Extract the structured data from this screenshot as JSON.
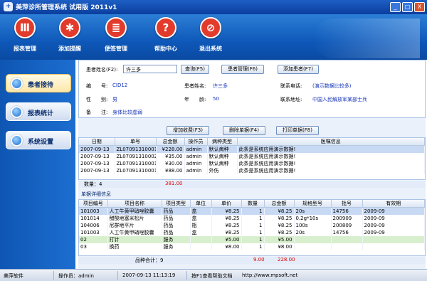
{
  "window": {
    "title": "美萍诊所管理系统 试用版 2011v1",
    "buttons": [
      "_",
      "□",
      "X"
    ]
  },
  "toolbar": [
    {
      "label": "报表管理",
      "icon": "bar-chart-icon",
      "glyph": "Ⅲ",
      "color": "#e23b2c"
    },
    {
      "label": "添加提醒",
      "icon": "alarm-clock-icon",
      "glyph": "✱",
      "color": "#e23b2c"
    },
    {
      "label": "便签管理",
      "icon": "notepad-icon",
      "glyph": "≣",
      "color": "#e23b2c"
    },
    {
      "label": "帮助中心",
      "icon": "help-icon",
      "glyph": "?",
      "color": "#e23b2c"
    },
    {
      "label": "退出系统",
      "icon": "exit-icon",
      "glyph": "⊘",
      "color": "#e23b2c"
    }
  ],
  "sidebar": [
    {
      "label": "患者接待",
      "active": true
    },
    {
      "label": "报表统计",
      "active": false
    },
    {
      "label": "系统设置",
      "active": false
    }
  ],
  "form": {
    "search_label": "患者姓名(F2):",
    "search_value": "许三多",
    "query_btn": "查询(F5)",
    "manage_btn": "患者管理(F6)",
    "add_btn": "添加患者(F7)",
    "name_label": "患者姓名:",
    "name_value": "许三多",
    "phone_label": "联系电话:",
    "phone_value": "(演示数据比较多)",
    "id_label": "编　　号:",
    "id_value": "CID12",
    "sex_label": "性　　别:",
    "sex_value": "男",
    "age_label": "年　　龄:",
    "age_value": "50",
    "addr_label": "联系地址:",
    "addr_value": "中国人民解放军某部士兵",
    "note_label": "备　　注:",
    "note_value": "身体比较虚弱"
  },
  "actions": {
    "add_charge": "增加收费(F3)",
    "delete_bill": "删除单据(F4)",
    "print_bill": "打印单据(F8)"
  },
  "orders": {
    "headers": [
      "日期",
      "单号",
      "总金额",
      "操作员",
      "病种类型",
      "医嘱信息"
    ],
    "rows": [
      [
        "2007-09-13",
        "ZL07091310001",
        "¥228.00",
        "admin",
        "默认病种",
        "此条是系统应用演示数据!"
      ],
      [
        "2007-09-13",
        "ZL07091310002",
        "¥35.00",
        "admin",
        "默认病种",
        "此条是系统应用演示数据!"
      ],
      [
        "2007-09-13",
        "ZL07091310001",
        "¥30.00",
        "admin",
        "默认病种",
        "此条是系统应用演示数据!"
      ],
      [
        "2007-09-13",
        "ZL07091310001",
        "¥88.00",
        "admin",
        "外伤",
        "此条是系统应用演示数据!"
      ]
    ],
    "count_label": "数量：4",
    "count_sum": "381.00"
  },
  "details": {
    "title": "单据详细信息",
    "headers": [
      "项目编号",
      "项目名称",
      "项目类型",
      "单位",
      "单价",
      "数量",
      "总金额",
      "规格型号",
      "批号",
      "有效期"
    ],
    "rows": [
      [
        "101003",
        "人工牛黄甲硝唑胶囊",
        "药品",
        "盒",
        "¥8.25",
        "1",
        "¥8.25",
        "20s",
        "14756",
        "2009-09"
      ],
      [
        "101014",
        "醋酸地塞米松片",
        "药品",
        "盒",
        "¥8.25",
        "1",
        "¥8.25",
        "0.2g*10s",
        "200909",
        "2009-09"
      ],
      [
        "104006",
        "尼群地平片",
        "药品",
        "瓶",
        "¥8.25",
        "1",
        "¥8.25",
        "100s",
        "200809",
        "2009-09"
      ],
      [
        "101003",
        "人工牛黄甲硝唑胶囊",
        "药品",
        "盒",
        "¥8.25",
        "1",
        "¥8.25",
        "20s",
        "14756",
        "2009-09"
      ],
      [
        "02",
        "打针",
        "服务",
        "",
        "¥5.00",
        "1",
        "¥5.00",
        "",
        "",
        ""
      ],
      [
        "03",
        "换药",
        "服务",
        "",
        "¥8.00",
        "1",
        "¥8.00",
        "",
        "",
        ""
      ]
    ],
    "sum_label": "品种合计：9",
    "sum_qty": "9.00",
    "sum_total": "228.00"
  },
  "status": {
    "company": "美萍软件",
    "operator": "操作员：admin",
    "time": "2007-09-13 11:13:19",
    "hint": "按F1查看帮助文档",
    "url": "http://www.mpsoft.net"
  }
}
